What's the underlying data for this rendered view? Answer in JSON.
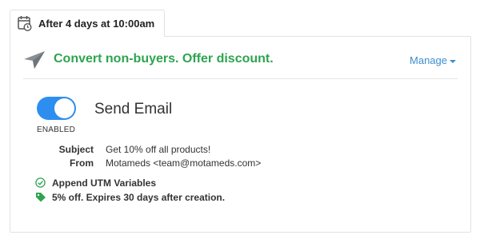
{
  "schedule": {
    "icon": "calendar-clock-icon",
    "label": "After 4 days at 10:00am"
  },
  "campaign": {
    "icon": "paper-plane-icon",
    "title": "Convert non-buyers. Offer discount.",
    "title_color": "#2ea44f",
    "manage_label": "Manage",
    "manage_color": "#3b8fd1"
  },
  "action": {
    "toggle_state": "on",
    "toggle_color": "#2d8ef0",
    "status_label": "ENABLED",
    "title": "Send Email"
  },
  "fields": [
    {
      "key": "Subject",
      "value": "Get 10% off all products!"
    },
    {
      "key": "From",
      "value": "Motameds <team@motameds.com>"
    }
  ],
  "features": [
    {
      "icon": "check-circle-icon",
      "label": "Append UTM Variables"
    },
    {
      "icon": "price-tag-icon",
      "label": "5% off. Expires 30 days after creation."
    }
  ]
}
